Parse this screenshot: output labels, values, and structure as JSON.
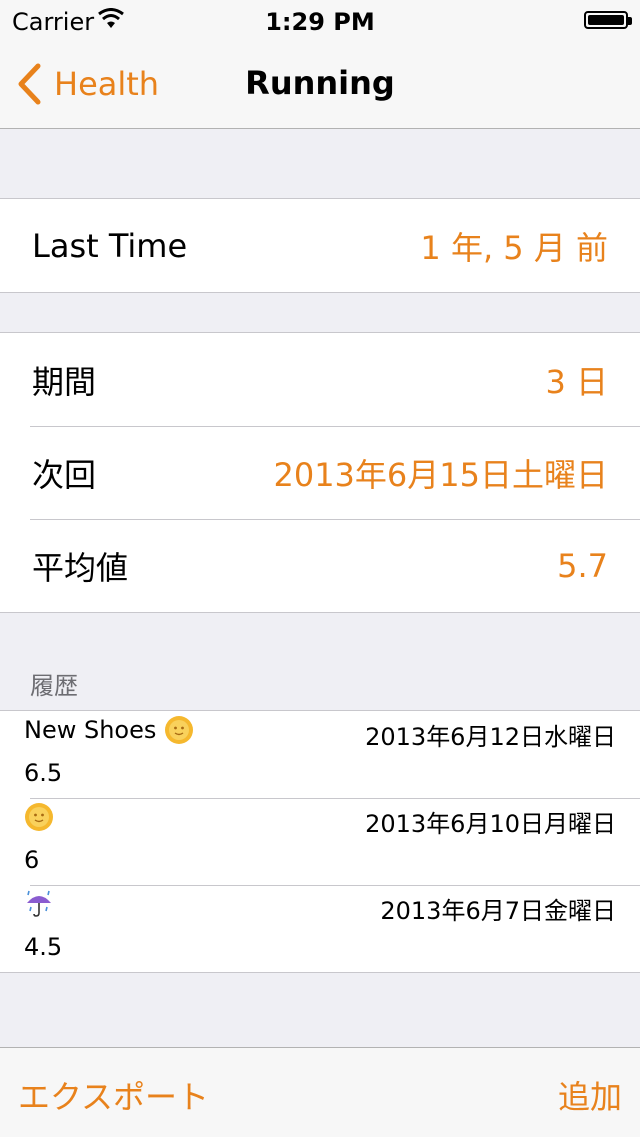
{
  "status_bar": {
    "carrier": "Carrier",
    "time": "1:29 PM"
  },
  "nav": {
    "back_label": "Health",
    "title": "Running"
  },
  "summary": {
    "label": "Last Time",
    "value": "1 年, 5 月 前"
  },
  "details": [
    {
      "label": "期間",
      "value": "3 日"
    },
    {
      "label": "次回",
      "value": "2013年6月15日土曜日"
    },
    {
      "label": "平均値",
      "value": "5.7"
    }
  ],
  "history": {
    "header": "履歴",
    "rows": [
      {
        "name": "New Shoes",
        "icon": "sun-icon",
        "date": "2013年6月12日水曜日",
        "value": "6.5"
      },
      {
        "name": "",
        "icon": "sun-icon",
        "date": "2013年6月10日月曜日",
        "value": "6"
      },
      {
        "name": "",
        "icon": "umbrella-rain-icon",
        "date": "2013年6月7日金曜日",
        "value": "4.5"
      }
    ]
  },
  "toolbar": {
    "export_label": "エクスポート",
    "add_label": "追加"
  },
  "colors": {
    "accent": "#e8821c",
    "background": "#efeff4"
  }
}
